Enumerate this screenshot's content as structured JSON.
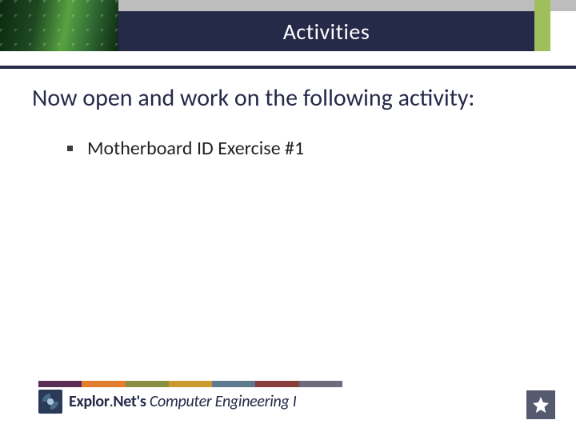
{
  "header": {
    "title": "Activities"
  },
  "content": {
    "intro": "Now open and work on the following activity:",
    "bullets": [
      "Motherboard ID Exercise #1"
    ]
  },
  "footer": {
    "brand_prefix": "Explor",
    "brand_dot": ".",
    "brand_net": "Net's ",
    "brand_course": "Computer Engineering I"
  }
}
